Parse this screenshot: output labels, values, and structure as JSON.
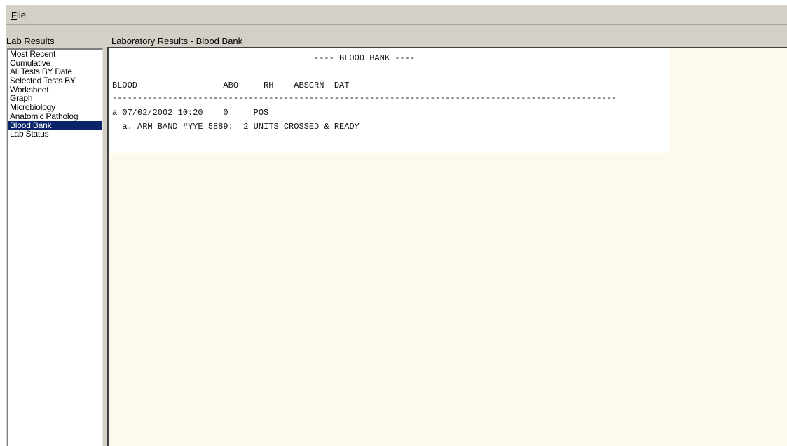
{
  "menu": {
    "file": "File",
    "file_mnemonic": "F",
    "file_rest": "ile"
  },
  "left_panel": {
    "title": "Lab Results",
    "items": [
      {
        "label": "Most Recent",
        "selected": false
      },
      {
        "label": "Cumulative",
        "selected": false
      },
      {
        "label": "All Tests BY Date",
        "selected": false
      },
      {
        "label": "Selected Tests BY",
        "selected": false
      },
      {
        "label": "Worksheet",
        "selected": false
      },
      {
        "label": "Graph",
        "selected": false
      },
      {
        "label": "Microbiology",
        "selected": false
      },
      {
        "label": "Anatomic Patholog",
        "selected": false
      },
      {
        "label": "Blood Bank",
        "selected": true
      },
      {
        "label": "Lab Status",
        "selected": false
      }
    ]
  },
  "main_panel": {
    "title": "Laboratory Results - Blood Bank",
    "report": {
      "heading": "---- BLOOD BANK ----",
      "columns": "BLOOD                 ABO     RH    ABSCRN  DAT",
      "separator": "----------------------------------------------------------------------------------------------------",
      "row": "a 07/02/2002 10:20    0     POS",
      "note": "  a. ARM BAND #YYE 5889:  2 UNITS CROSSED & READY"
    }
  },
  "colors": {
    "window_bg": "#d4d0c8",
    "list_bg": "#ffffff",
    "selected_bg": "#0a246a",
    "selected_text": "#ffffff",
    "report_bg": "#fdfaed"
  }
}
